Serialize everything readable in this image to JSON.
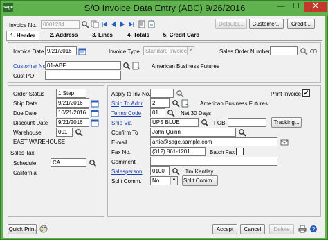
{
  "window": {
    "title": "S/O Invoice Data Entry (ABC) 9/26/2016",
    "app_icon_text": "sage",
    "minimize": "—",
    "maximize": "☐",
    "close": "✕"
  },
  "toolbar": {
    "invoice_no_label": "Invoice No.",
    "invoice_no_value": "0001234",
    "defaults_label": "Defaults...",
    "customer_label": "Customer...",
    "credit_label": "Credit..."
  },
  "tabs": [
    {
      "label": "1. Header"
    },
    {
      "label": "2. Address"
    },
    {
      "label": "3. Lines"
    },
    {
      "label": "4. Totals"
    },
    {
      "label": "5. Credit Card"
    }
  ],
  "header": {
    "invoice_date_label": "Invoice Date",
    "invoice_date_value": "9/21/2016",
    "invoice_type_label": "Invoice Type",
    "invoice_type_value": "Standard Invoice",
    "sales_order_label": "Sales Order Number",
    "sales_order_value": "",
    "customer_no_label": "Customer No.",
    "customer_no_value": "01-ABF",
    "customer_name": "American Business Futures",
    "cust_po_label": "Cust PO",
    "cust_po_value": ""
  },
  "left_panel": {
    "order_status_label": "Order Status",
    "order_status_value": "1 Step",
    "ship_date_label": "Ship Date",
    "ship_date_value": "9/21/2016",
    "due_date_label": "Due Date",
    "due_date_value": "10/21/2016",
    "discount_date_label": "Discount Date",
    "discount_date_value": "9/21/2016",
    "warehouse_label": "Warehouse",
    "warehouse_value": "001",
    "warehouse_name": "EAST WAREHOUSE",
    "sales_tax_label": "Sales Tax",
    "schedule_label": "Schedule",
    "schedule_value": "CA",
    "schedule_name": "California"
  },
  "right_panel": {
    "apply_inv_label": "Apply to Inv No.",
    "apply_inv_value": "",
    "print_invoice_label": "Print Invoice",
    "print_invoice_checked": "✓",
    "ship_to_label": "Ship To Addr",
    "ship_to_value": "2",
    "ship_to_name": "American Business Futures",
    "terms_label": "Terms Code",
    "terms_value": "01",
    "terms_name": "Net 30 Days",
    "ship_via_label": "Ship Via",
    "ship_via_value": "UPS BLUE",
    "fob_label": "FOB",
    "fob_value": "",
    "tracking_label": "Tracking...",
    "confirm_to_label": "Confirm To",
    "confirm_to_value": "John Quinn",
    "email_label": "E-mail",
    "email_value": "artie@sage.sample.com",
    "fax_label": "Fax No.",
    "fax_value": "(312) 861-1201",
    "batch_fax_label": "Batch Fax",
    "comment_label": "Comment",
    "comment_value": "",
    "salesperson_label": "Salesperson",
    "salesperson_value": "0100",
    "salesperson_name": "Jim Kentley",
    "split_comm_label": "Split Comm.",
    "split_comm_value": "No",
    "split_comm_button": "Split Comm..."
  },
  "footer": {
    "quick_print": "Quick Print",
    "accept": "Accept",
    "cancel": "Cancel",
    "delete": "Delete"
  },
  "colors": {
    "title_bar": "#5fb24e",
    "close_button": "#c0392b",
    "link": "#1a3fb0"
  }
}
